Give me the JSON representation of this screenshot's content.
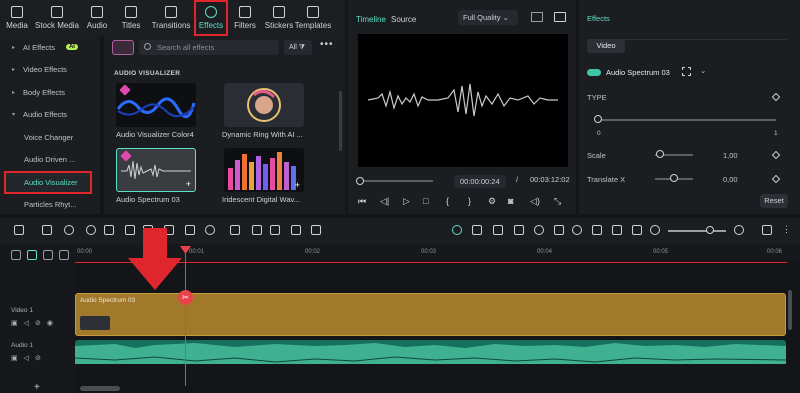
{
  "toolbar": {
    "items": [
      {
        "label": "Media",
        "icon": "media-icon"
      },
      {
        "label": "Stock Media",
        "icon": "stock-media-icon"
      },
      {
        "label": "Audio",
        "icon": "audio-icon"
      },
      {
        "label": "Titles",
        "icon": "titles-icon"
      },
      {
        "label": "Transitions",
        "icon": "transitions-icon"
      },
      {
        "label": "Effects",
        "icon": "effects-icon"
      },
      {
        "label": "Filters",
        "icon": "filters-icon"
      },
      {
        "label": "Stickers",
        "icon": "stickers-icon"
      },
      {
        "label": "Templates",
        "icon": "templates-icon"
      }
    ]
  },
  "categories": {
    "items": [
      {
        "label": "AI Effects"
      },
      {
        "label": "Video Effects"
      },
      {
        "label": "Body Effects"
      },
      {
        "label": "Audio Effects"
      },
      {
        "label": "Voice Changer"
      },
      {
        "label": "Audio Driven ..."
      },
      {
        "label": "Audio Visualizer"
      },
      {
        "label": "Particles Rhyt..."
      }
    ],
    "ai_badge": "AI"
  },
  "effects": {
    "search_placeholder": "Search all effects",
    "filter_label": "All",
    "section_title": "AUDIO VISUALIZER",
    "cards": [
      {
        "caption": "Audio Visualizer Color4"
      },
      {
        "caption": "Dynamic Ring With AI ..."
      },
      {
        "caption": "Audio Spectrum 03"
      },
      {
        "caption": "Iridescent Digital Wav..."
      }
    ]
  },
  "preview": {
    "tab_timeline": "Timeline",
    "tab_source": "Source",
    "quality": "Full Quality",
    "current_time": "00:00:00:24",
    "separator": "/",
    "total_time": "00:03:12:02"
  },
  "properties": {
    "title": "Effects",
    "tab_video": "Video",
    "effect_name": "Audio Spectrum 03",
    "type_label": "TYPE",
    "type_min": "0",
    "type_max": "1",
    "scale_label": "Scale",
    "scale_value": "1,00",
    "translate_label": "Translate X",
    "translate_value": "0,00",
    "reset_label": "Reset"
  },
  "timeline": {
    "ruler_ticks": [
      "00:00",
      "00:01",
      "00:02",
      "00:03",
      "00:04",
      "00:05",
      "00:06"
    ],
    "video_track_label": "Video 1",
    "audio_track_label": "Audio 1",
    "clip_name": "Audio Spectrum 03",
    "add_track_symbol": "+"
  },
  "colors": {
    "accent": "#5ce0c6",
    "highlight_box": "#e0262d",
    "video_clip": "#a07a2a",
    "audio_clip": "#15715e"
  }
}
